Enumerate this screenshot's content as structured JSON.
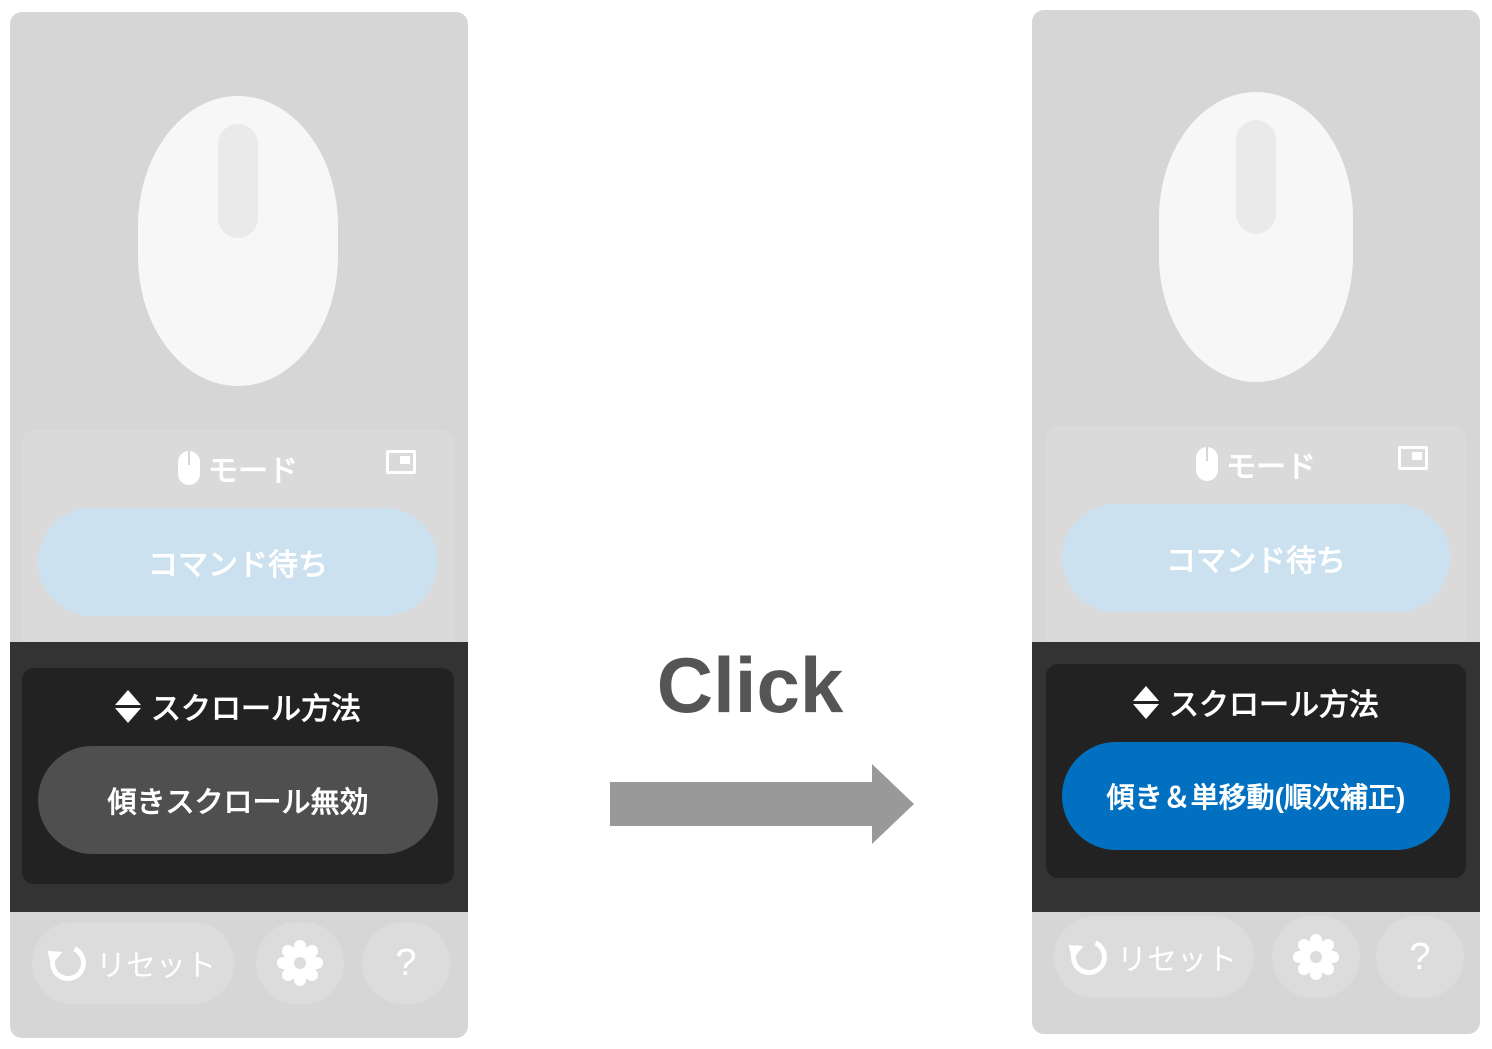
{
  "before": {
    "mode_label": "モード",
    "command_button": "コマンド待ち",
    "scroll_title": "スクロール方法",
    "scroll_button": "傾きスクロール無効",
    "reset_label": "リセット",
    "help_label": "?"
  },
  "after": {
    "mode_label": "モード",
    "command_button": "コマンド待ち",
    "scroll_title": "スクロール方法",
    "scroll_button": "傾き＆単移動(順次補正)",
    "reset_label": "リセット",
    "help_label": "?"
  },
  "transition": {
    "label": "Click"
  },
  "colors": {
    "panel_bg": "#d6d6d6",
    "scroll_band": "#333333",
    "scroll_card": "#222222",
    "button_inactive": "#4f4f4f",
    "button_active": "#0170c1",
    "command_button": "#cbe1f0",
    "arrow": "#999999",
    "click_text": "#555555"
  },
  "icons": [
    "mouse-icon",
    "picture-in-picture-icon",
    "up-down-icon",
    "reset-icon",
    "gear-icon",
    "help-icon",
    "right-arrow-icon"
  ]
}
